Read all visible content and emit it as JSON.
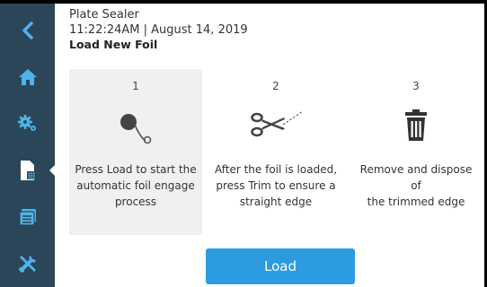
{
  "header": {
    "app_name": "Plate Sealer",
    "datetime": "11:22:24AM | August 14, 2019",
    "subtitle": "Load New Foil"
  },
  "sidebar": {
    "items": [
      {
        "icon": "back-chevron-icon"
      },
      {
        "icon": "home-icon"
      },
      {
        "icon": "settings-gears-icon"
      },
      {
        "icon": "document-icon",
        "active": true
      },
      {
        "icon": "calendar-list-icon"
      },
      {
        "icon": "tools-icon"
      }
    ]
  },
  "steps": [
    {
      "number": "1",
      "icon": "foil-roll-icon",
      "lines": [
        "Press Load to start the",
        "automatic foil engage",
        "process"
      ]
    },
    {
      "number": "2",
      "icon": "scissors-cut-icon",
      "lines": [
        "After the foil is loaded,",
        "press Trim to ensure a",
        "straight edge"
      ]
    },
    {
      "number": "3",
      "icon": "trash-icon",
      "lines": [
        "Remove and dispose of",
        "the trimmed edge"
      ]
    }
  ],
  "actions": {
    "load_label": "Load"
  },
  "colors": {
    "sidebar": "#2b4658",
    "sidebar_icon": "#4fb3ea",
    "primary_button": "#2d9be0",
    "active_step_bg": "#f0f0f0"
  }
}
